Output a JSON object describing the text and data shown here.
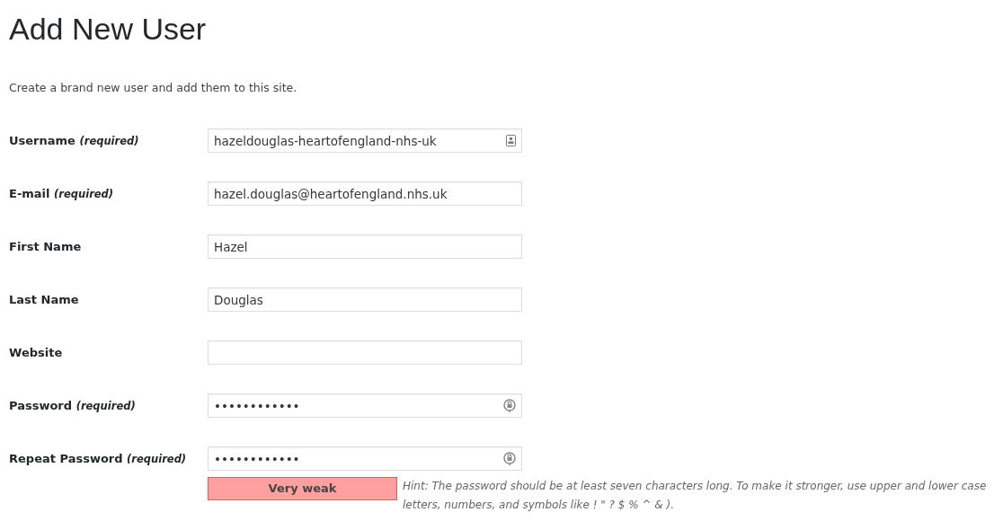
{
  "title": "Add New User",
  "description": "Create a brand new user and add them to this site.",
  "fields": [
    {
      "kind": "username",
      "label": "Username",
      "required_note": "(required)",
      "value": "hazeldouglas-heartofengland-nhs-uk"
    },
    {
      "kind": "email",
      "label": "E-mail",
      "required_note": "(required)",
      "value": "hazel.douglas@heartofengland.nhs.uk"
    },
    {
      "kind": "text",
      "label": "First Name",
      "value": "Hazel"
    },
    {
      "kind": "text",
      "label": "Last Name",
      "value": "Douglas"
    },
    {
      "kind": "url",
      "label": "Website"
    },
    {
      "kind": "password",
      "label": "Password",
      "required_note": "(required)",
      "value": "••••••••••••"
    },
    {
      "kind": "password",
      "label": "Repeat Password",
      "required_note": "(required)",
      "value": "••••••••••••"
    }
  ],
  "strength": {
    "label": "Very weak",
    "kind": "short"
  },
  "hint": "Hint: The password should be at least seven characters long. To make it stronger, use upper and lower case letters, numbers, and symbols like ! \" ? $ % ^ & )."
}
